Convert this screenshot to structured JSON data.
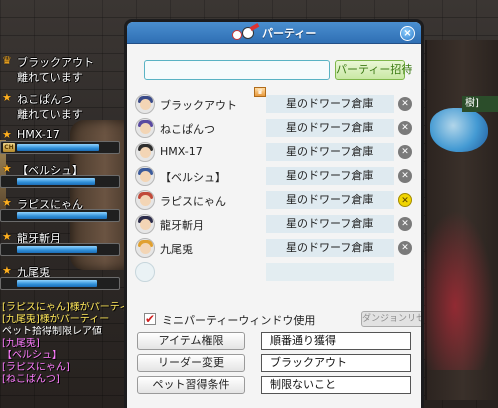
{
  "window": {
    "title": "パーティー",
    "close_label": "×"
  },
  "search": {
    "value": "",
    "invite_label": "パーティー招待"
  },
  "members": [
    {
      "name": "ブラックアウト",
      "map": "星のドワーフ倉庫",
      "leader": true,
      "self": false,
      "hair": "#3a4a88"
    },
    {
      "name": "ねこぱんつ",
      "map": "星のドワーフ倉庫",
      "leader": false,
      "self": false,
      "hair": "#5a4aa0"
    },
    {
      "name": "HMX-17",
      "map": "星のドワーフ倉庫",
      "leader": false,
      "self": false,
      "hair": "#2f2f2f"
    },
    {
      "name": "【ベルシュ】",
      "map": "星のドワーフ倉庫",
      "leader": false,
      "self": false,
      "hair": "#3c5a9a"
    },
    {
      "name": "ラピスにゃん",
      "map": "星のドワーフ倉庫",
      "leader": false,
      "self": true,
      "hair": "#c14a3a"
    },
    {
      "name": "龍牙斬月",
      "map": "星のドワーフ倉庫",
      "leader": false,
      "self": false,
      "hair": "#2c2c4a"
    },
    {
      "name": "九尾兎",
      "map": "星のドワーフ倉庫",
      "leader": false,
      "self": false,
      "hair": "#e0a030"
    }
  ],
  "options": {
    "mini_window_label": "ミニパーティーウィンドウ使用",
    "mini_window_checked": "✔",
    "dungeon_reset_label": "ダンジョンリセット"
  },
  "settings": {
    "item_rights_label": "アイテム権限",
    "item_rights_value": "順番通り獲得",
    "leader_change_label": "リーダー変更",
    "leader_value": "ブラックアウト",
    "pet_learn_label": "ペット習得条件",
    "pet_learn_value": "制限ないこと"
  },
  "party_hud": [
    {
      "name": "ブラックアウト",
      "status": "離れています",
      "hp": null
    },
    {
      "name": "ねこぱんつ",
      "status": "離れています",
      "hp": null
    },
    {
      "name": "HMX-17",
      "status": "",
      "hp": 0.82
    },
    {
      "name": "【ベルシュ】",
      "status": "",
      "hp": 0.78
    },
    {
      "name": "ラピスにゃん",
      "status": "",
      "hp": 0.9
    },
    {
      "name": "龍牙斬月",
      "status": "",
      "hp": 0.8
    },
    {
      "name": "九尾兎",
      "status": "",
      "hp": 0.8
    }
  ],
  "hud_badge": "CH",
  "chat": [
    {
      "text": "[ラピスにゃん]様がパーティ",
      "color": "yel"
    },
    {
      "text": "[九尾兎]様がパーティー",
      "color": "yel"
    },
    {
      "text": "ペット拾得制限レア値",
      "color": "wht"
    },
    {
      "text": "[九尾兎]",
      "color": "mag"
    },
    {
      "text": "【ベルシュ】",
      "color": "mag"
    },
    {
      "text": "[ラピスにゃん]",
      "color": "mag"
    },
    {
      "text": "[ねこぱんつ]",
      "color": "mag"
    }
  ],
  "bg_sign": "樹]"
}
